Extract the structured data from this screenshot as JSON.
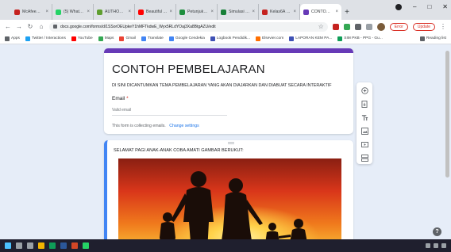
{
  "browser": {
    "tabs": [
      {
        "title": "McAfee® W...",
        "color": "#c5221f",
        "active": false
      },
      {
        "title": "(5) WhatsApp",
        "color": "#25d366",
        "active": false
      },
      {
        "title": "AUTHOR GU...",
        "color": "#5f9e2f",
        "active": false
      },
      {
        "title": "Beautiful ...",
        "color": "#ff0000",
        "active": false
      },
      {
        "title": "Petunjuk Te...",
        "color": "#1e8e3e",
        "active": false
      },
      {
        "title": "Simulasi KP...",
        "color": "#188038",
        "active": false
      },
      {
        "title": "Kelas6A K...",
        "color": "#c5221f",
        "active": false
      },
      {
        "title": "CONTOH PE...",
        "color": "#673ab7",
        "active": true
      }
    ],
    "url": "docs.google.com/forms/d/1SSorOEUpkeY1hMFTkdwE_Wyx5RLdYOaj3Xa8BtgAZU/edit",
    "error_label": "Error",
    "update_label": "Update",
    "bookmarks": [
      {
        "label": "Apps",
        "color": "#5f6368"
      },
      {
        "label": "Twitter / Interactions",
        "color": "#1da1f2"
      },
      {
        "label": "YouTube",
        "color": "#ff0000"
      },
      {
        "label": "Maps",
        "color": "#34a853"
      },
      {
        "label": "Gmail",
        "color": "#ea4335"
      },
      {
        "label": "Translate",
        "color": "#4285f4"
      },
      {
        "label": "Google Cendekia",
        "color": "#4285f4"
      },
      {
        "label": "Logbook Pendidik...",
        "color": "#3f51b5"
      },
      {
        "label": "Elsevier.com",
        "color": "#ff6f00"
      },
      {
        "label": "LAPORAN KEM PA...",
        "color": "#3f51b5"
      },
      {
        "label": "SIM PKB - PPG - Gu...",
        "color": "#0f9d58"
      }
    ],
    "reading_list": "Reading list"
  },
  "form": {
    "title": "CONTOH PEMBELAJARAN",
    "description": "DI SINI DICANTUMKAN TEMA PEMBELAJARAN YANG AKAN DIAJARKAN DAN DIABUAT SECARA INTERAKTIF",
    "email_label": "Email",
    "email_required": "*",
    "email_placeholder": "Valid email",
    "collecting_note": "This form is collecting emails.",
    "change_settings": "Change settings",
    "question_text": "SELAMAT PAGI ANAK-ANAK COBA AMATI GAMBAR BERUKUT:"
  },
  "toolbar": {
    "icons": [
      "add-question-icon",
      "import-questions-icon",
      "add-title-icon",
      "add-image-icon",
      "add-video-icon",
      "add-section-icon"
    ]
  },
  "colors": {
    "accent": "#673ab7",
    "focus": "#4285f4",
    "page_bg": "#e6edf8"
  }
}
